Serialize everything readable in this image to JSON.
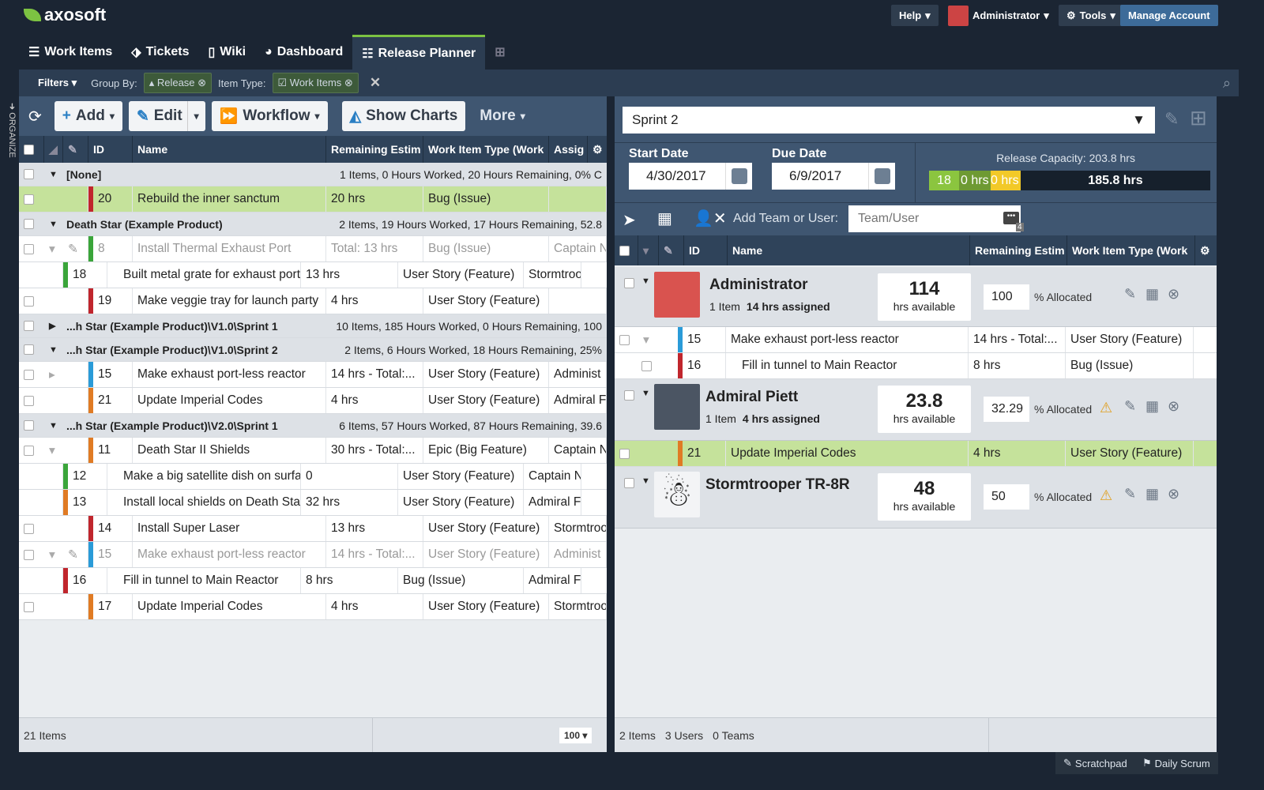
{
  "brand": "axosoft",
  "topbar": {
    "help": "Help",
    "user": "Administrator",
    "tools": "Tools",
    "manage": "Manage Account"
  },
  "tabs": [
    "Work Items",
    "Tickets",
    "Wiki",
    "Dashboard",
    "Release Planner"
  ],
  "filters": {
    "filters": "Filters",
    "group_by": "Group By:",
    "group_val": "Release",
    "item_type": "Item Type:",
    "item_val": "Work Items"
  },
  "organize": "ORGANIZE",
  "toolbar": {
    "add": "Add",
    "edit": "Edit",
    "workflow": "Workflow",
    "charts": "Show Charts",
    "more": "More"
  },
  "left_columns": [
    "ID",
    "Name",
    "Remaining Estim",
    "Work Item Type (Work",
    "Assig"
  ],
  "left_rows": [
    {
      "kind": "group",
      "open": true,
      "label": "[None]",
      "summary": "1 Items, 0 Hours Worked, 20 Hours Remaining, 0% C"
    },
    {
      "kind": "item",
      "hl": true,
      "color": "#c0262d",
      "id": "20",
      "name": "Rebuild the inner sanctum",
      "rem": "20 hrs",
      "type": "Bug (Issue)",
      "assigned": ""
    },
    {
      "kind": "group",
      "open": true,
      "label": "Death Star (Example Product)",
      "summary": "2 Items, 19 Hours Worked, 17 Hours Remaining, 52.8"
    },
    {
      "kind": "item",
      "dim": true,
      "parent": true,
      "color": "#3aa53a",
      "id": "8",
      "name": "Install Thermal Exhaust Port",
      "rem": "Total: 13 hrs",
      "type": "Bug (Issue)",
      "assigned": "Captain N"
    },
    {
      "kind": "item",
      "child": true,
      "color": "#3aa53a",
      "id": "18",
      "name": "Built metal grate for exhaust port",
      "rem": "13 hrs",
      "type": "User Story (Feature)",
      "assigned": "Stormtroo"
    },
    {
      "kind": "item",
      "color": "#c0262d",
      "id": "19",
      "name": "Make veggie tray for launch party",
      "rem": "4 hrs",
      "type": "User Story (Feature)",
      "assigned": ""
    },
    {
      "kind": "group",
      "open": false,
      "label": "...h Star (Example Product)\\V1.0\\Sprint 1",
      "summary": "10 Items, 185 Hours Worked, 0 Hours Remaining, 100"
    },
    {
      "kind": "group",
      "open": true,
      "label": "...h Star (Example Product)\\V1.0\\Sprint 2",
      "summary": "2 Items, 6 Hours Worked, 18 Hours Remaining, 25%"
    },
    {
      "kind": "item",
      "collapsed": true,
      "color": "#2a9bd8",
      "id": "15",
      "name": "Make exhaust port-less reactor",
      "rem": "14 hrs - Total:...",
      "type": "User Story (Feature)",
      "assigned": "Administ"
    },
    {
      "kind": "item",
      "color": "#e07b24",
      "id": "21",
      "name": "Update Imperial Codes",
      "rem": "4 hrs",
      "type": "User Story (Feature)",
      "assigned": "Admiral F"
    },
    {
      "kind": "group",
      "open": true,
      "label": "...h Star (Example Product)\\V2.0\\Sprint 1",
      "summary": "6 Items, 57 Hours Worked, 87 Hours Remaining, 39.6"
    },
    {
      "kind": "item",
      "parent": true,
      "color": "#e07b24",
      "id": "11",
      "name": "Death Star II Shields",
      "rem": "30 hrs - Total:...",
      "type": "Epic (Big Feature)",
      "assigned": "Captain N"
    },
    {
      "kind": "item",
      "child": true,
      "color": "#3aa53a",
      "id": "12",
      "name": "Make a big satellite dish on surface",
      "rem": "0",
      "type": "User Story (Feature)",
      "assigned": "Captain N"
    },
    {
      "kind": "item",
      "child": true,
      "color": "#e07b24",
      "id": "13",
      "name": "Install local shields on Death Star",
      "rem": "32 hrs",
      "type": "User Story (Feature)",
      "assigned": "Admiral F"
    },
    {
      "kind": "item",
      "color": "#c0262d",
      "id": "14",
      "name": "Install Super Laser",
      "rem": "13 hrs",
      "type": "User Story (Feature)",
      "assigned": "Stormtroo"
    },
    {
      "kind": "item",
      "dim": true,
      "parent": true,
      "color": "#2a9bd8",
      "id": "15",
      "name": "Make exhaust port-less reactor",
      "rem": "14 hrs - Total:...",
      "type": "User Story (Feature)",
      "assigned": "Administ"
    },
    {
      "kind": "item",
      "child": true,
      "color": "#c0262d",
      "id": "16",
      "name": "Fill in tunnel to Main Reactor",
      "rem": "8 hrs",
      "type": "Bug (Issue)",
      "assigned": "Admiral F"
    },
    {
      "kind": "item",
      "color": "#e07b24",
      "id": "17",
      "name": "Update Imperial Codes",
      "rem": "4 hrs",
      "type": "User Story (Feature)",
      "assigned": "Stormtroo"
    }
  ],
  "left_footer": {
    "count": "21 Items",
    "page_size": "100"
  },
  "release": {
    "name": "Sprint 2",
    "start_label": "Start Date",
    "start": "4/30/2017",
    "due_label": "Due Date",
    "due": "6/9/2017",
    "capacity": "Release Capacity: 203.8 hrs",
    "seg1": "18",
    "seg2": "0 hrs",
    "seg3": "0 hrs",
    "remaining": "185.8 hrs",
    "add_label": "Add Team or User:",
    "add_placeholder": "Team/User",
    "badge": "4"
  },
  "right_columns": [
    "ID",
    "Name",
    "Remaining Estim",
    "Work Item Type (Work"
  ],
  "users": [
    {
      "name": "Administrator",
      "items": "1 Item",
      "assigned": "14 hrs assigned",
      "hrs": "114",
      "hrs_label": "hrs available",
      "pct": "100",
      "pct_label": "% Allocated",
      "warn": false,
      "rows": [
        {
          "color": "#2a9bd8",
          "id": "15",
          "name": "Make exhaust port-less reactor",
          "rem": "14 hrs - Total:...",
          "type": "User Story (Feature)",
          "parent": true
        },
        {
          "color": "#c0262d",
          "id": "16",
          "name": "Fill in tunnel to Main Reactor",
          "rem": "8 hrs",
          "type": "Bug (Issue)",
          "child": true
        }
      ]
    },
    {
      "name": "Admiral Piett",
      "items": "1 Item",
      "assigned": "4 hrs assigned",
      "hrs": "23.8",
      "hrs_label": "hrs available",
      "pct": "32.29",
      "pct_label": "% Allocated",
      "warn": true,
      "rows": [
        {
          "color": "#e07b24",
          "id": "21",
          "name": "Update Imperial Codes",
          "rem": "4 hrs",
          "type": "User Story (Feature)",
          "hl": true
        }
      ]
    },
    {
      "name": "Stormtrooper TR-8R",
      "items": "",
      "assigned": "",
      "hrs": "48",
      "hrs_label": "hrs available",
      "pct": "50",
      "pct_label": "% Allocated",
      "warn": true,
      "rows": []
    }
  ],
  "right_footer": {
    "items": "2 Items",
    "users": "3 Users",
    "teams": "0 Teams"
  },
  "bottom": {
    "scratchpad": "Scratchpad",
    "scrum": "Daily Scrum"
  }
}
